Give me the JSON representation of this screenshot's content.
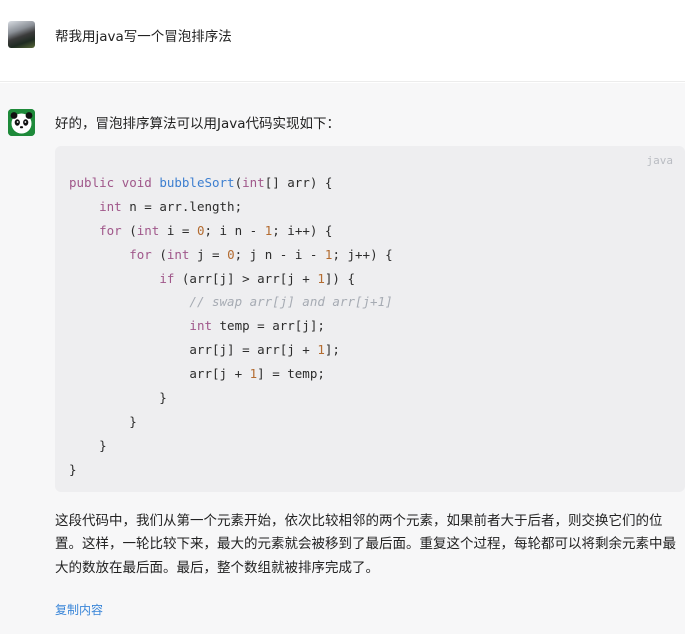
{
  "user": {
    "avatar": "user-photo-avatar",
    "message": "帮我用java写一个冒泡排序法"
  },
  "bot": {
    "avatar": "panda-avatar",
    "intro": "好的，冒泡排序算法可以用Java代码实现如下：",
    "code": {
      "language": "java",
      "lines": [
        "public void bubbleSort(int[] arr) {",
        "    int n = arr.length;",
        "    for (int i = 0; i n - 1; i++) {",
        "        for (int j = 0; j n - i - 1; j++) {",
        "            if (arr[j] > arr[j + 1]) {",
        "                // swap arr[j] and arr[j+1]",
        "                int temp = arr[j];",
        "                arr[j] = arr[j + 1];",
        "                arr[j + 1] = temp;",
        "            }",
        "        }",
        "    }",
        "}"
      ]
    },
    "paragraph": "这段代码中，我们从第一个元素开始，依次比较相邻的两个元素，如果前者大于后者，则交换它们的位置。这样，一轮比较下来，最大的元素就会被移到了最后面。重复这个过程，每轮都可以将剩余元素中最大的数放在最后面。最后，整个数组就被排序完成了。",
    "copy_label": "复制内容"
  },
  "colors": {
    "keyword": "#a0578a",
    "function": "#3d7fd0",
    "number": "#b36b30",
    "comment": "#a6abb3",
    "link": "#3a86d8"
  }
}
